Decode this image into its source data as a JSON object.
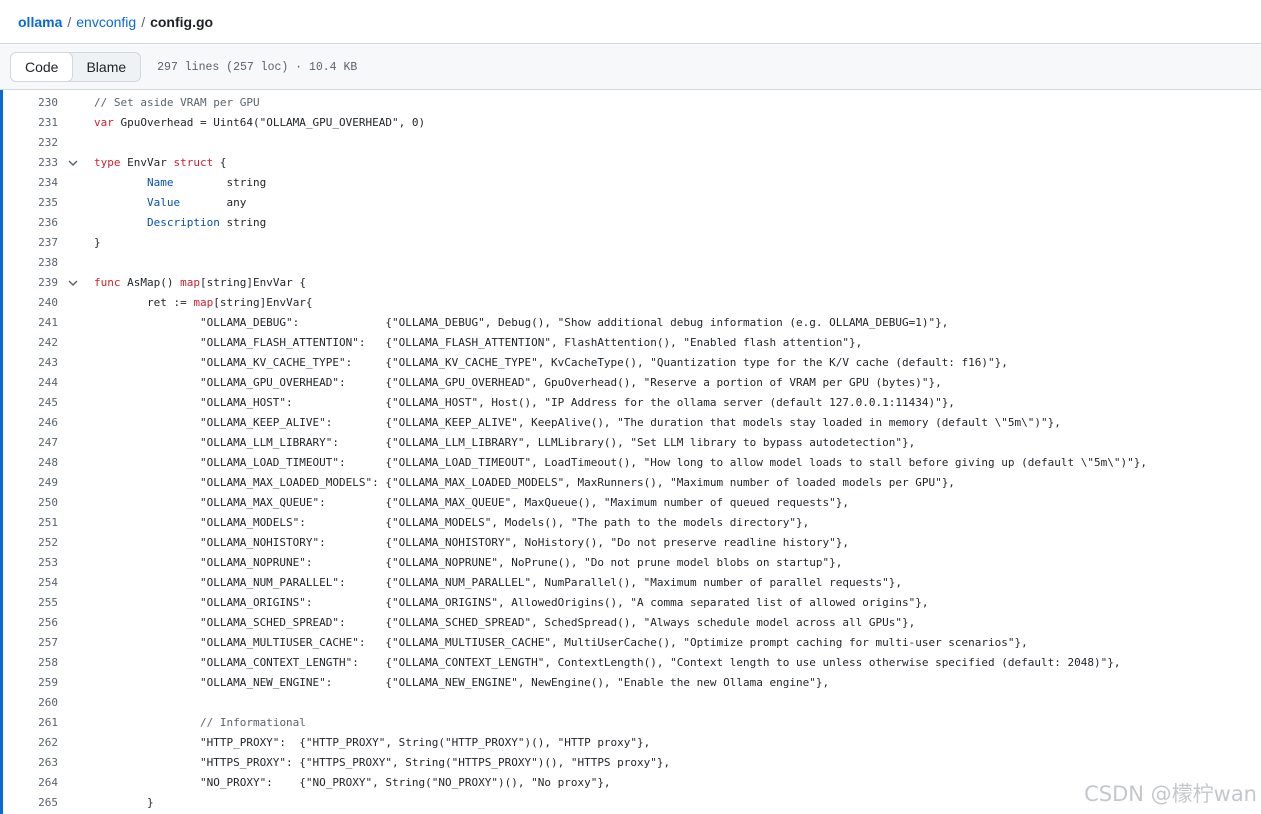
{
  "breadcrumb": {
    "repo": "ollama",
    "folder": "envconfig",
    "file": "config.go",
    "separator": "/"
  },
  "toolbar": {
    "code_label": "Code",
    "blame_label": "Blame",
    "file_info": "297 lines (257 loc) · 10.4 KB"
  },
  "code": [
    {
      "n": "230",
      "fold": false,
      "s": [
        {
          "c": "cm",
          "t": "// Set aside VRAM per GPU"
        }
      ]
    },
    {
      "n": "231",
      "fold": false,
      "s": [
        {
          "c": "kw",
          "t": "var"
        },
        {
          "c": "",
          "t": " GpuOverhead = Uint64(\"OLLAMA_GPU_OVERHEAD\", 0)"
        }
      ]
    },
    {
      "n": "232",
      "fold": false,
      "s": []
    },
    {
      "n": "233",
      "fold": true,
      "s": [
        {
          "c": "kw",
          "t": "type"
        },
        {
          "c": "",
          "t": " EnvVar "
        },
        {
          "c": "kw",
          "t": "struct"
        },
        {
          "c": "",
          "t": " {"
        }
      ]
    },
    {
      "n": "234",
      "fold": false,
      "s": [
        {
          "c": "",
          "t": "        "
        },
        {
          "c": "fld",
          "t": "Name"
        },
        {
          "c": "",
          "t": "        string"
        }
      ]
    },
    {
      "n": "235",
      "fold": false,
      "s": [
        {
          "c": "",
          "t": "        "
        },
        {
          "c": "fld",
          "t": "Value"
        },
        {
          "c": "",
          "t": "       any"
        }
      ]
    },
    {
      "n": "236",
      "fold": false,
      "s": [
        {
          "c": "",
          "t": "        "
        },
        {
          "c": "fld",
          "t": "Description"
        },
        {
          "c": "",
          "t": " string"
        }
      ]
    },
    {
      "n": "237",
      "fold": false,
      "s": [
        {
          "c": "",
          "t": "}"
        }
      ]
    },
    {
      "n": "238",
      "fold": false,
      "s": []
    },
    {
      "n": "239",
      "fold": true,
      "s": [
        {
          "c": "kw",
          "t": "func"
        },
        {
          "c": "",
          "t": " AsMap() "
        },
        {
          "c": "kw",
          "t": "map"
        },
        {
          "c": "",
          "t": "[string]EnvVar {"
        }
      ]
    },
    {
      "n": "240",
      "fold": false,
      "s": [
        {
          "c": "",
          "t": "        ret := "
        },
        {
          "c": "kw",
          "t": "map"
        },
        {
          "c": "",
          "t": "[string]EnvVar{"
        }
      ]
    },
    {
      "n": "241",
      "fold": false,
      "s": [
        {
          "c": "",
          "t": "                \"OLLAMA_DEBUG\":             {\"OLLAMA_DEBUG\", Debug(), \"Show additional debug information (e.g. OLLAMA_DEBUG=1)\"},"
        }
      ]
    },
    {
      "n": "242",
      "fold": false,
      "s": [
        {
          "c": "",
          "t": "                \"OLLAMA_FLASH_ATTENTION\":   {\"OLLAMA_FLASH_ATTENTION\", FlashAttention(), \"Enabled flash attention\"},"
        }
      ]
    },
    {
      "n": "243",
      "fold": false,
      "s": [
        {
          "c": "",
          "t": "                \"OLLAMA_KV_CACHE_TYPE\":     {\"OLLAMA_KV_CACHE_TYPE\", KvCacheType(), \"Quantization type for the K/V cache (default: f16)\"},"
        }
      ]
    },
    {
      "n": "244",
      "fold": false,
      "s": [
        {
          "c": "",
          "t": "                \"OLLAMA_GPU_OVERHEAD\":      {\"OLLAMA_GPU_OVERHEAD\", GpuOverhead(), \"Reserve a portion of VRAM per GPU (bytes)\"},"
        }
      ]
    },
    {
      "n": "245",
      "fold": false,
      "s": [
        {
          "c": "",
          "t": "                \"OLLAMA_HOST\":              {\"OLLAMA_HOST\", Host(), \"IP Address for the ollama server (default 127.0.0.1:11434)\"},"
        }
      ]
    },
    {
      "n": "246",
      "fold": false,
      "s": [
        {
          "c": "",
          "t": "                \"OLLAMA_KEEP_ALIVE\":        {\"OLLAMA_KEEP_ALIVE\", KeepAlive(), \"The duration that models stay loaded in memory (default \\\"5m\\\")\"},"
        }
      ]
    },
    {
      "n": "247",
      "fold": false,
      "s": [
        {
          "c": "",
          "t": "                \"OLLAMA_LLM_LIBRARY\":       {\"OLLAMA_LLM_LIBRARY\", LLMLibrary(), \"Set LLM library to bypass autodetection\"},"
        }
      ]
    },
    {
      "n": "248",
      "fold": false,
      "s": [
        {
          "c": "",
          "t": "                \"OLLAMA_LOAD_TIMEOUT\":      {\"OLLAMA_LOAD_TIMEOUT\", LoadTimeout(), \"How long to allow model loads to stall before giving up (default \\\"5m\\\")\"},"
        }
      ]
    },
    {
      "n": "249",
      "fold": false,
      "s": [
        {
          "c": "",
          "t": "                \"OLLAMA_MAX_LOADED_MODELS\": {\"OLLAMA_MAX_LOADED_MODELS\", MaxRunners(), \"Maximum number of loaded models per GPU\"},"
        }
      ]
    },
    {
      "n": "250",
      "fold": false,
      "s": [
        {
          "c": "",
          "t": "                \"OLLAMA_MAX_QUEUE\":         {\"OLLAMA_MAX_QUEUE\", MaxQueue(), \"Maximum number of queued requests\"},"
        }
      ]
    },
    {
      "n": "251",
      "fold": false,
      "s": [
        {
          "c": "",
          "t": "                \"OLLAMA_MODELS\":            {\"OLLAMA_MODELS\", Models(), \"The path to the models directory\"},"
        }
      ]
    },
    {
      "n": "252",
      "fold": false,
      "s": [
        {
          "c": "",
          "t": "                \"OLLAMA_NOHISTORY\":         {\"OLLAMA_NOHISTORY\", NoHistory(), \"Do not preserve readline history\"},"
        }
      ]
    },
    {
      "n": "253",
      "fold": false,
      "s": [
        {
          "c": "",
          "t": "                \"OLLAMA_NOPRUNE\":           {\"OLLAMA_NOPRUNE\", NoPrune(), \"Do not prune model blobs on startup\"},"
        }
      ]
    },
    {
      "n": "254",
      "fold": false,
      "s": [
        {
          "c": "",
          "t": "                \"OLLAMA_NUM_PARALLEL\":      {\"OLLAMA_NUM_PARALLEL\", NumParallel(), \"Maximum number of parallel requests\"},"
        }
      ]
    },
    {
      "n": "255",
      "fold": false,
      "s": [
        {
          "c": "",
          "t": "                \"OLLAMA_ORIGINS\":           {\"OLLAMA_ORIGINS\", AllowedOrigins(), \"A comma separated list of allowed origins\"},"
        }
      ]
    },
    {
      "n": "256",
      "fold": false,
      "s": [
        {
          "c": "",
          "t": "                \"OLLAMA_SCHED_SPREAD\":      {\"OLLAMA_SCHED_SPREAD\", SchedSpread(), \"Always schedule model across all GPUs\"},"
        }
      ]
    },
    {
      "n": "257",
      "fold": false,
      "s": [
        {
          "c": "",
          "t": "                \"OLLAMA_MULTIUSER_CACHE\":   {\"OLLAMA_MULTIUSER_CACHE\", MultiUserCache(), \"Optimize prompt caching for multi-user scenarios\"},"
        }
      ]
    },
    {
      "n": "258",
      "fold": false,
      "s": [
        {
          "c": "",
          "t": "                \"OLLAMA_CONTEXT_LENGTH\":    {\"OLLAMA_CONTEXT_LENGTH\", ContextLength(), \"Context length to use unless otherwise specified (default: 2048)\"},"
        }
      ]
    },
    {
      "n": "259",
      "fold": false,
      "s": [
        {
          "c": "",
          "t": "                \"OLLAMA_NEW_ENGINE\":        {\"OLLAMA_NEW_ENGINE\", NewEngine(), \"Enable the new Ollama engine\"},"
        }
      ]
    },
    {
      "n": "260",
      "fold": false,
      "s": []
    },
    {
      "n": "261",
      "fold": false,
      "s": [
        {
          "c": "",
          "t": "                "
        },
        {
          "c": "cm",
          "t": "// Informational"
        }
      ]
    },
    {
      "n": "262",
      "fold": false,
      "s": [
        {
          "c": "",
          "t": "                \"HTTP_PROXY\":  {\"HTTP_PROXY\", String(\"HTTP_PROXY\")(), \"HTTP proxy\"},"
        }
      ]
    },
    {
      "n": "263",
      "fold": false,
      "s": [
        {
          "c": "",
          "t": "                \"HTTPS_PROXY\": {\"HTTPS_PROXY\", String(\"HTTPS_PROXY\")(), \"HTTPS proxy\"},"
        }
      ]
    },
    {
      "n": "264",
      "fold": false,
      "s": [
        {
          "c": "",
          "t": "                \"NO_PROXY\":    {\"NO_PROXY\", String(\"NO_PROXY\")(), \"No proxy\"},"
        }
      ]
    },
    {
      "n": "265",
      "fold": false,
      "s": [
        {
          "c": "",
          "t": "        }"
        }
      ]
    }
  ],
  "watermark": "CSDN @檬柠wan",
  "icons": {
    "fold": "chevron-down-icon"
  },
  "colors": {
    "link": "#0969da",
    "keyword": "#cf222e",
    "field": "#0550ae",
    "comment": "#59636e"
  }
}
